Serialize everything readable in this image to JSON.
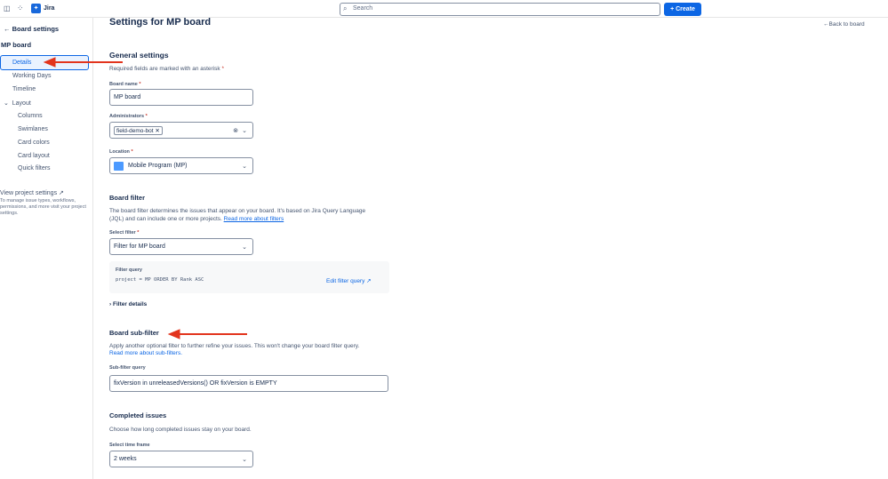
{
  "topbar": {
    "app_name": "Jira",
    "search_placeholder": "Search",
    "create_label": "Create"
  },
  "sidebar": {
    "back_label": "Board settings",
    "board_name": "MP board",
    "items": [
      {
        "label": "Details"
      },
      {
        "label": "Working Days"
      },
      {
        "label": "Timeline"
      },
      {
        "label": "Layout"
      }
    ],
    "layout_items": [
      {
        "label": "Columns"
      },
      {
        "label": "Swimlanes"
      },
      {
        "label": "Card colors"
      },
      {
        "label": "Card layout"
      },
      {
        "label": "Quick filters"
      }
    ],
    "project_settings_label": "View project settings",
    "project_settings_desc": "To manage issue types, workflows, permissions, and more visit your project settings."
  },
  "main": {
    "title": "Settings for MP board",
    "back_to_board": "Back to board",
    "general": {
      "heading": "General settings",
      "required_note": "Required fields are marked with an asterisk",
      "board_name_label": "Board name",
      "board_name_value": "MP board",
      "admins_label": "Administrators",
      "admin_tag": "field-demo-bot",
      "location_label": "Location",
      "location_value": "Mobile Program (MP)"
    },
    "board_filter": {
      "heading": "Board filter",
      "desc": "The board filter determines the issues that appear on your board. It's based on Jira Query Language (JQL) and can include one or more projects.",
      "link": "Read more about filters",
      "select_label": "Select filter",
      "select_value": "Filter for MP board",
      "query_label": "Filter query",
      "query": "project = MP ORDER BY Rank ASC",
      "edit_link": "Edit filter query",
      "details_toggle": "Filter details"
    },
    "sub_filter": {
      "heading": "Board sub-filter",
      "desc": "Apply another optional filter to further refine your issues. This won't change your board filter query.",
      "link": "Read more about sub-filters.",
      "query_label": "Sub-filter query",
      "query_value": "fixVersion in unreleasedVersions() OR fixVersion is EMPTY"
    },
    "completed": {
      "heading": "Completed issues",
      "desc": "Choose how long completed issues stay on your board.",
      "select_label": "Select time frame",
      "select_value": "2 weeks"
    }
  },
  "colors": {
    "accent": "#0c66e4",
    "annotation": "#e2341d"
  }
}
